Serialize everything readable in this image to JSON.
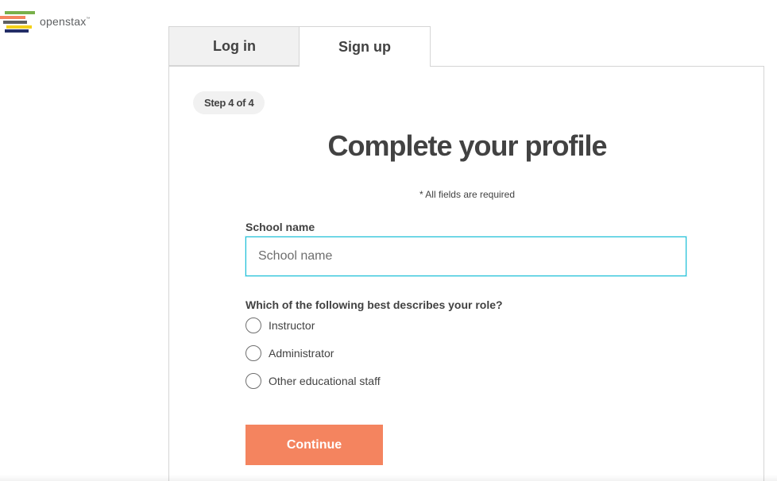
{
  "brand": {
    "name": "openstax",
    "trademark": "™",
    "stripe_colors": [
      "#78b04a",
      "#f4845f",
      "#5e6062",
      "#f4d019",
      "#232e66"
    ]
  },
  "tabs": [
    {
      "label": "Log in",
      "active": false
    },
    {
      "label": "Sign up",
      "active": true
    }
  ],
  "form": {
    "step_label": "Step 4 of 4",
    "title": "Complete your profile",
    "required_note": "* All fields are required",
    "school_field": {
      "label": "School name",
      "placeholder": "School name",
      "value": ""
    },
    "role_question": "Which of the following best describes your role?",
    "role_options": [
      {
        "label": "Instructor",
        "selected": false
      },
      {
        "label": "Administrator",
        "selected": false
      },
      {
        "label": "Other educational staff",
        "selected": false
      }
    ],
    "continue_label": "Continue"
  },
  "colors": {
    "accent_button": "#f4845f",
    "input_focus": "#1ec0d8",
    "text": "#424242"
  }
}
